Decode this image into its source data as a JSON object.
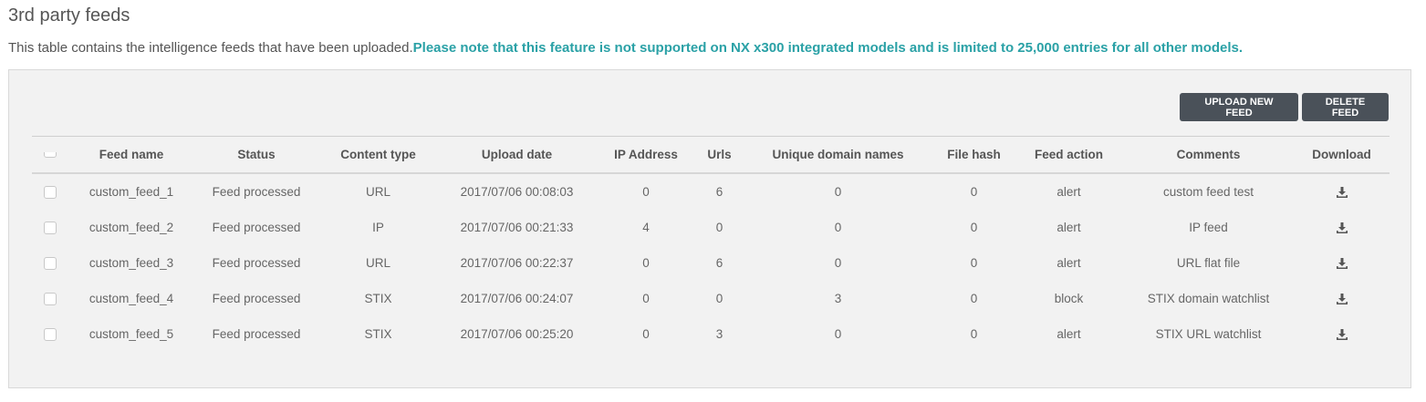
{
  "page": {
    "title": "3rd party feeds",
    "description": "This table contains the intelligence feeds that have been uploaded.",
    "note": "Please note that this feature is not supported on NX x300 integrated models and is limited to 25,000 entries for all other models."
  },
  "toolbar": {
    "upload_label": "UPLOAD NEW FEED",
    "delete_label": "DELETE FEED"
  },
  "colors": {
    "note": "#2aa1a6",
    "button_bg": "#4a5159",
    "panel_bg": "#f2f2f2"
  },
  "table": {
    "headers": {
      "name": "Feed name",
      "status": "Status",
      "type": "Content type",
      "date": "Upload date",
      "ip": "IP Address",
      "urls": "Urls",
      "udn": "Unique domain names",
      "hash": "File hash",
      "action": "Feed action",
      "comments": "Comments",
      "download": "Download"
    },
    "download_icon": "download-icon",
    "rows": [
      {
        "name": "custom_feed_1",
        "status": "Feed processed",
        "type": "URL",
        "date": "2017/07/06 00:08:03",
        "ip": "0",
        "urls": "6",
        "udn": "0",
        "hash": "0",
        "action": "alert",
        "comments": "custom feed test"
      },
      {
        "name": "custom_feed_2",
        "status": "Feed processed",
        "type": "IP",
        "date": "2017/07/06 00:21:33",
        "ip": "4",
        "urls": "0",
        "udn": "0",
        "hash": "0",
        "action": "alert",
        "comments": "IP feed"
      },
      {
        "name": "custom_feed_3",
        "status": "Feed processed",
        "type": "URL",
        "date": "2017/07/06 00:22:37",
        "ip": "0",
        "urls": "6",
        "udn": "0",
        "hash": "0",
        "action": "alert",
        "comments": "URL flat file"
      },
      {
        "name": "custom_feed_4",
        "status": "Feed processed",
        "type": "STIX",
        "date": "2017/07/06 00:24:07",
        "ip": "0",
        "urls": "0",
        "udn": "3",
        "hash": "0",
        "action": "block",
        "comments": "STIX domain watchlist"
      },
      {
        "name": "custom_feed_5",
        "status": "Feed processed",
        "type": "STIX",
        "date": "2017/07/06 00:25:20",
        "ip": "0",
        "urls": "3",
        "udn": "0",
        "hash": "0",
        "action": "alert",
        "comments": "STIX URL watchlist"
      }
    ]
  }
}
